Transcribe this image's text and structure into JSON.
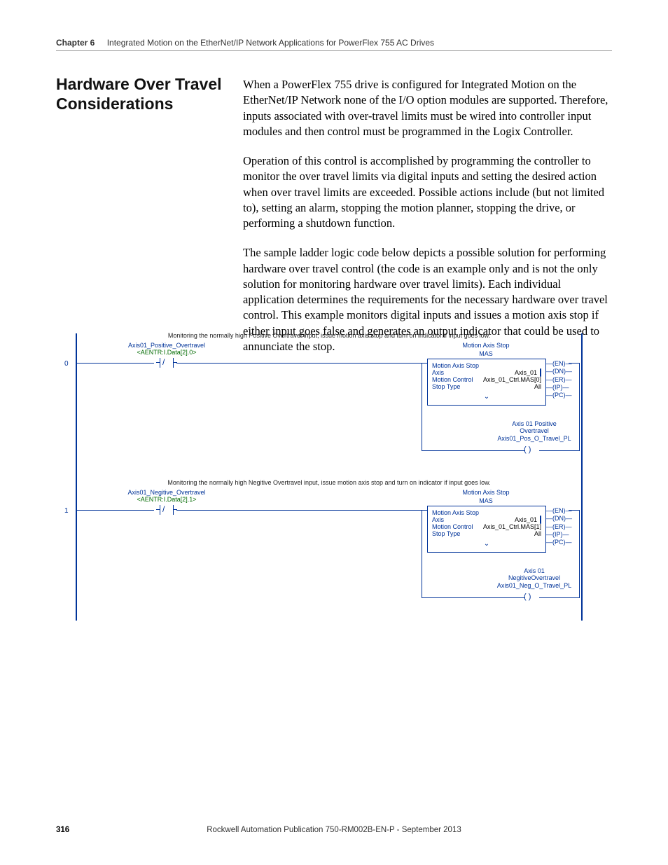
{
  "header": {
    "chapter_label": "Chapter 6",
    "chapter_title": "Integrated Motion on the EtherNet/IP Network Applications for PowerFlex 755 AC Drives"
  },
  "section_title": "Hardware Over Travel Considerations",
  "paragraphs": {
    "p1": "When a PowerFlex 755 drive is configured for Integrated Motion on the EtherNet/IP Network none of the I/O option modules are supported. Therefore, inputs associated with over-travel limits must be wired into controller input modules and then control must be programmed in the Logix Controller.",
    "p2": "Operation of this control is accomplished by programming the controller to monitor the over travel limits via digital inputs and setting the desired action when over travel limits are exceeded. Possible actions include (but not limited to), setting an alarm, stopping the motion planner, stopping the drive, or performing a shutdown function.",
    "p3": "The sample ladder logic code below depicts a possible solution for performing hardware over travel control (the code is an example only and is not the only solution for monitoring hardware over travel limits). Each individual application determines the requirements for the necessary hardware over travel control. This example monitors digital inputs and issues a motion axis stop if either input goes false and generates an output indicator that could be used to annunciate the stop."
  },
  "ladder": {
    "rungs": [
      {
        "num": "0",
        "comment": "Monitoring the normally high Positive Overtravel input, issue motion axis stop and turn on indicator if input goes low.",
        "input_tag": "Axis01_Positive_Overtravel",
        "input_alias": "<AENTR:I.Data[2].0>",
        "output_title": "Motion Axis Stop",
        "mas_tag": "MAS",
        "instr_title": "Motion Axis Stop",
        "rows": [
          {
            "k": "Axis",
            "v": "Axis_01"
          },
          {
            "k": "Motion Control",
            "v": "Axis_01_Ctrl.MAS[0]"
          },
          {
            "k": "Stop Type",
            "v": "All"
          }
        ],
        "flags": [
          "(EN)",
          "(DN)",
          "(ER)",
          "(IP)",
          "(PC)"
        ],
        "branch_label_lines": [
          "Axis 01 Positive",
          "Overtravel"
        ],
        "branch_tag": "Axis01_Pos_O_Travel_PL"
      },
      {
        "num": "1",
        "comment": "Monitoring the normally high Negitive Overtravel input, issue motion axis stop and turn on indicator if input goes low.",
        "input_tag": "Axis01_Negitive_Overtravel",
        "input_alias": "<AENTR:I.Data[2].1>",
        "output_title": "Motion Axis Stop",
        "mas_tag": "MAS",
        "instr_title": "Motion Axis Stop",
        "rows": [
          {
            "k": "Axis",
            "v": "Axis_01"
          },
          {
            "k": "Motion Control",
            "v": "Axis_01_Ctrl.MAS[1]"
          },
          {
            "k": "Stop Type",
            "v": "All"
          }
        ],
        "flags": [
          "(EN)",
          "(DN)",
          "(ER)",
          "(IP)",
          "(PC)"
        ],
        "branch_label_lines": [
          "Axis 01",
          "NegitiveOvertravel"
        ],
        "branch_tag": "Axis01_Neg_O_Travel_PL"
      }
    ]
  },
  "footer": {
    "page": "316",
    "pub": "Rockwell Automation Publication 750-RM002B-EN-P - September 2013"
  }
}
